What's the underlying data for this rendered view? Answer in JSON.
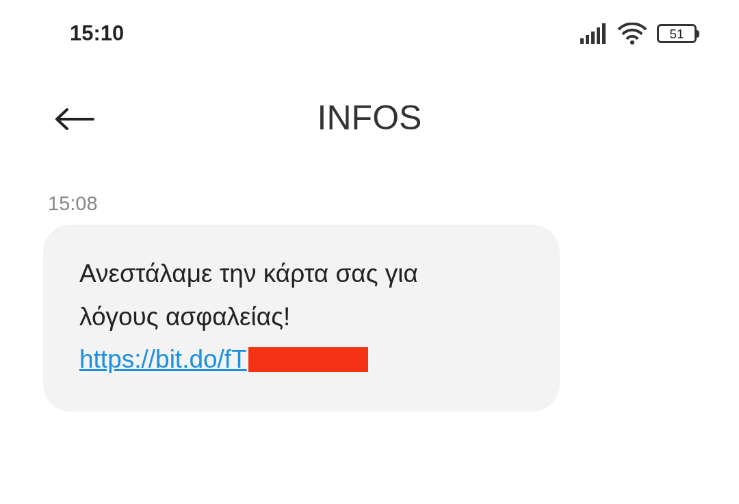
{
  "status_bar": {
    "time": "15:10",
    "battery": "51"
  },
  "header": {
    "title": "INFOS"
  },
  "messages": [
    {
      "time": "15:08",
      "text": "Ανεστάλαμε την κάρτα σας για λόγους ασφαλείας!",
      "link": "https://bit.do/fT",
      "redacted": true
    }
  ]
}
